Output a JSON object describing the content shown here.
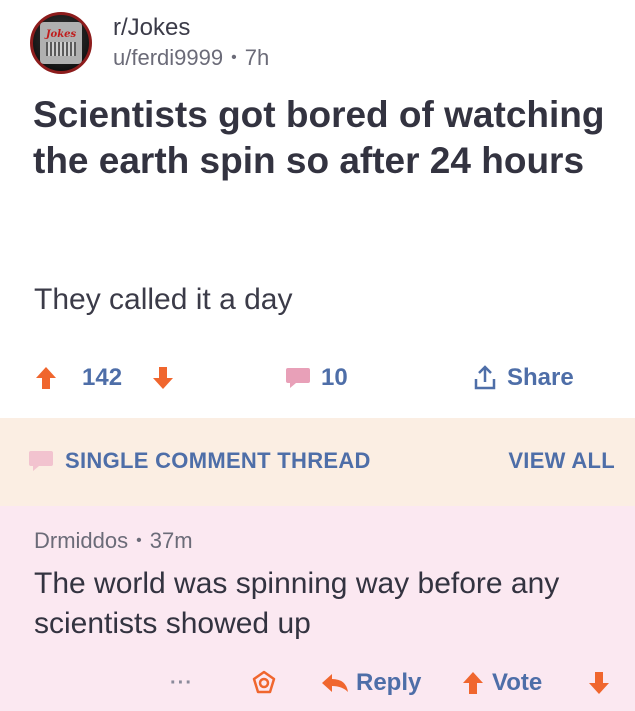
{
  "post": {
    "subreddit": "r/Jokes",
    "author": "u/ferdi9999",
    "separator": "•",
    "age": "7h",
    "avatar_text": "Jokes",
    "title": "Scientists got bored of watching the earth spin so after 24 hours",
    "body": "They called it a day",
    "score": "142",
    "comment_count": "10",
    "share_label": "Share"
  },
  "thread_banner": {
    "label": "SINGLE COMMENT THREAD",
    "view_all": "VIEW ALL"
  },
  "comment": {
    "author": "Drmiddos",
    "separator": "•",
    "age": "37m",
    "text": "The world was spinning way before any scientists showed up",
    "more": "···",
    "reply_label": "Reply",
    "vote_label": "Vote"
  },
  "colors": {
    "upvote": "#f0662e",
    "downvote": "#f0662e",
    "link": "#4e6ea8",
    "comment_icon": "#e8a0b8",
    "banner_bg": "#fbeee3",
    "comment_bg": "#fbe8f1"
  },
  "icons": {
    "upvote": "arrow-up-icon",
    "downvote": "arrow-down-icon",
    "comments": "comment-bubble-icon",
    "share": "share-icon",
    "award": "award-icon",
    "reply": "reply-arrow-icon",
    "more": "more-dots-icon"
  }
}
